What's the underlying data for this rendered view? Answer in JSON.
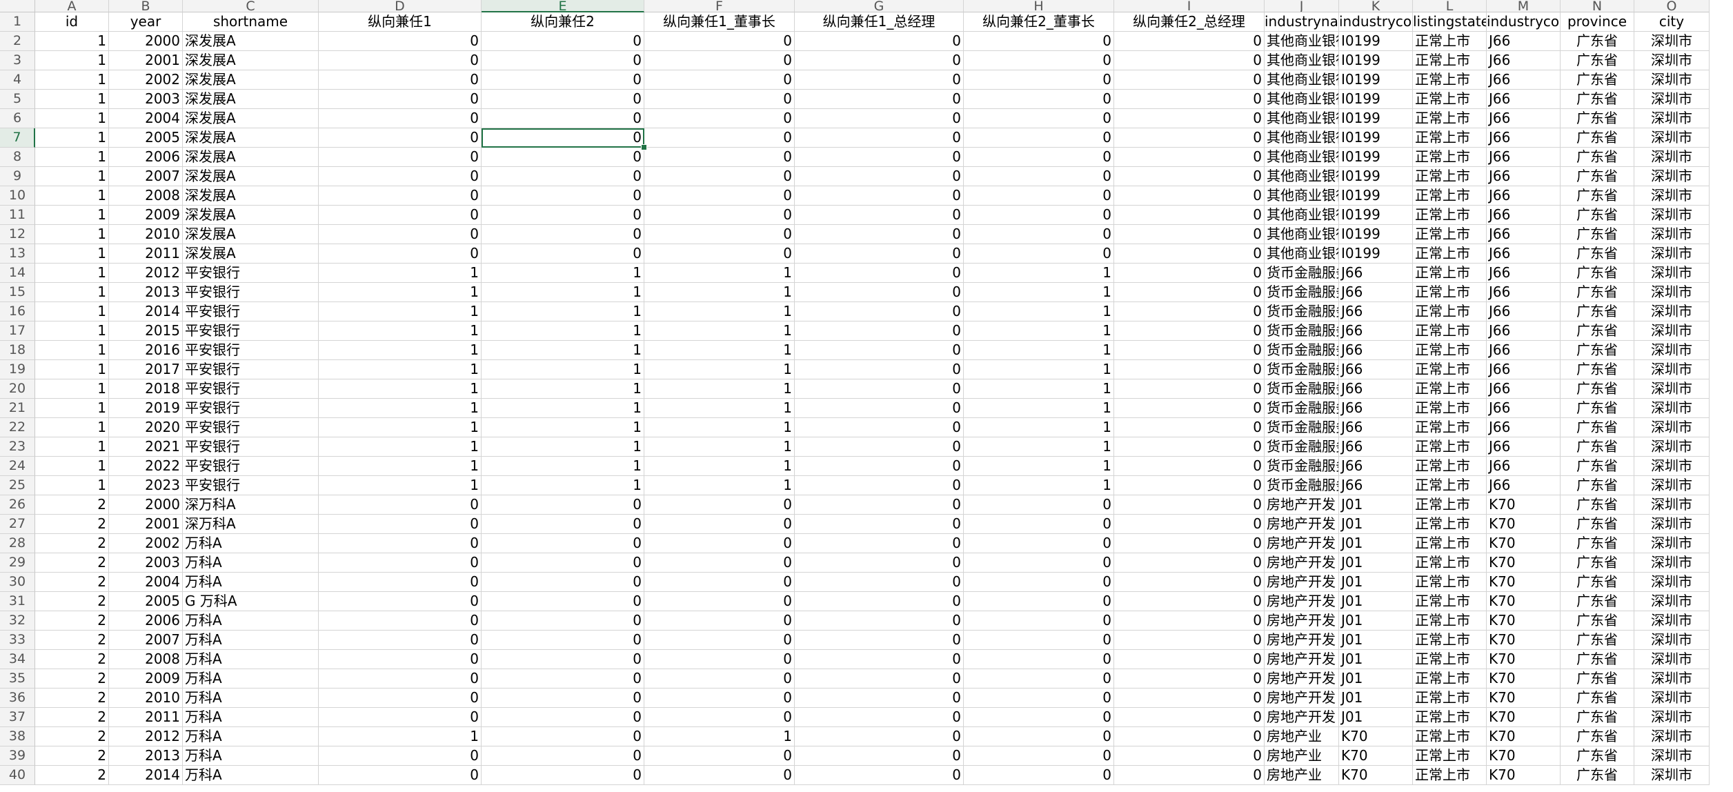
{
  "sheet": {
    "col_letters": [
      "A",
      "B",
      "C",
      "D",
      "E",
      "F",
      "G",
      "H",
      "I",
      "J",
      "K",
      "L",
      "M",
      "N",
      "O"
    ],
    "headers": [
      "id",
      "year",
      "shortname",
      "纵向兼任1",
      "纵向兼任2",
      "纵向兼任1_董事长",
      "纵向兼任1_总经理",
      "纵向兼任2_董事长",
      "纵向兼任2_总经理",
      "industryname",
      "industrycode",
      "listingstate",
      "industrycode",
      "province",
      "city"
    ],
    "active_cell": "E7",
    "rows": [
      [
        "1",
        "2000",
        "深发展A",
        "0",
        "0",
        "0",
        "0",
        "0",
        "0",
        "其他商业银行",
        "I0199",
        "正常上市",
        "J66",
        "广东省",
        "深圳市"
      ],
      [
        "1",
        "2001",
        "深发展A",
        "0",
        "0",
        "0",
        "0",
        "0",
        "0",
        "其他商业银行",
        "I0199",
        "正常上市",
        "J66",
        "广东省",
        "深圳市"
      ],
      [
        "1",
        "2002",
        "深发展A",
        "0",
        "0",
        "0",
        "0",
        "0",
        "0",
        "其他商业银行",
        "I0199",
        "正常上市",
        "J66",
        "广东省",
        "深圳市"
      ],
      [
        "1",
        "2003",
        "深发展A",
        "0",
        "0",
        "0",
        "0",
        "0",
        "0",
        "其他商业银行",
        "I0199",
        "正常上市",
        "J66",
        "广东省",
        "深圳市"
      ],
      [
        "1",
        "2004",
        "深发展A",
        "0",
        "0",
        "0",
        "0",
        "0",
        "0",
        "其他商业银行",
        "I0199",
        "正常上市",
        "J66",
        "广东省",
        "深圳市"
      ],
      [
        "1",
        "2005",
        "深发展A",
        "0",
        "0",
        "0",
        "0",
        "0",
        "0",
        "其他商业银行",
        "I0199",
        "正常上市",
        "J66",
        "广东省",
        "深圳市"
      ],
      [
        "1",
        "2006",
        "深发展A",
        "0",
        "0",
        "0",
        "0",
        "0",
        "0",
        "其他商业银行",
        "I0199",
        "正常上市",
        "J66",
        "广东省",
        "深圳市"
      ],
      [
        "1",
        "2007",
        "深发展A",
        "0",
        "0",
        "0",
        "0",
        "0",
        "0",
        "其他商业银行",
        "I0199",
        "正常上市",
        "J66",
        "广东省",
        "深圳市"
      ],
      [
        "1",
        "2008",
        "深发展A",
        "0",
        "0",
        "0",
        "0",
        "0",
        "0",
        "其他商业银行",
        "I0199",
        "正常上市",
        "J66",
        "广东省",
        "深圳市"
      ],
      [
        "1",
        "2009",
        "深发展A",
        "0",
        "0",
        "0",
        "0",
        "0",
        "0",
        "其他商业银行",
        "I0199",
        "正常上市",
        "J66",
        "广东省",
        "深圳市"
      ],
      [
        "1",
        "2010",
        "深发展A",
        "0",
        "0",
        "0",
        "0",
        "0",
        "0",
        "其他商业银行",
        "I0199",
        "正常上市",
        "J66",
        "广东省",
        "深圳市"
      ],
      [
        "1",
        "2011",
        "深发展A",
        "0",
        "0",
        "0",
        "0",
        "0",
        "0",
        "其他商业银行",
        "I0199",
        "正常上市",
        "J66",
        "广东省",
        "深圳市"
      ],
      [
        "1",
        "2012",
        "平安银行",
        "1",
        "1",
        "1",
        "0",
        "1",
        "0",
        "货币金融服务",
        "J66",
        "正常上市",
        "J66",
        "广东省",
        "深圳市"
      ],
      [
        "1",
        "2013",
        "平安银行",
        "1",
        "1",
        "1",
        "0",
        "1",
        "0",
        "货币金融服务",
        "J66",
        "正常上市",
        "J66",
        "广东省",
        "深圳市"
      ],
      [
        "1",
        "2014",
        "平安银行",
        "1",
        "1",
        "1",
        "0",
        "1",
        "0",
        "货币金融服务",
        "J66",
        "正常上市",
        "J66",
        "广东省",
        "深圳市"
      ],
      [
        "1",
        "2015",
        "平安银行",
        "1",
        "1",
        "1",
        "0",
        "1",
        "0",
        "货币金融服务",
        "J66",
        "正常上市",
        "J66",
        "广东省",
        "深圳市"
      ],
      [
        "1",
        "2016",
        "平安银行",
        "1",
        "1",
        "1",
        "0",
        "1",
        "0",
        "货币金融服务",
        "J66",
        "正常上市",
        "J66",
        "广东省",
        "深圳市"
      ],
      [
        "1",
        "2017",
        "平安银行",
        "1",
        "1",
        "1",
        "0",
        "1",
        "0",
        "货币金融服务",
        "J66",
        "正常上市",
        "J66",
        "广东省",
        "深圳市"
      ],
      [
        "1",
        "2018",
        "平安银行",
        "1",
        "1",
        "1",
        "0",
        "1",
        "0",
        "货币金融服务",
        "J66",
        "正常上市",
        "J66",
        "广东省",
        "深圳市"
      ],
      [
        "1",
        "2019",
        "平安银行",
        "1",
        "1",
        "1",
        "0",
        "1",
        "0",
        "货币金融服务",
        "J66",
        "正常上市",
        "J66",
        "广东省",
        "深圳市"
      ],
      [
        "1",
        "2020",
        "平安银行",
        "1",
        "1",
        "1",
        "0",
        "1",
        "0",
        "货币金融服务",
        "J66",
        "正常上市",
        "J66",
        "广东省",
        "深圳市"
      ],
      [
        "1",
        "2021",
        "平安银行",
        "1",
        "1",
        "1",
        "0",
        "1",
        "0",
        "货币金融服务",
        "J66",
        "正常上市",
        "J66",
        "广东省",
        "深圳市"
      ],
      [
        "1",
        "2022",
        "平安银行",
        "1",
        "1",
        "1",
        "0",
        "1",
        "0",
        "货币金融服务",
        "J66",
        "正常上市",
        "J66",
        "广东省",
        "深圳市"
      ],
      [
        "1",
        "2023",
        "平安银行",
        "1",
        "1",
        "1",
        "0",
        "1",
        "0",
        "货币金融服务",
        "J66",
        "正常上市",
        "J66",
        "广东省",
        "深圳市"
      ],
      [
        "2",
        "2000",
        "深万科A",
        "0",
        "0",
        "0",
        "0",
        "0",
        "0",
        "房地产开发",
        "J01",
        "正常上市",
        "K70",
        "广东省",
        "深圳市"
      ],
      [
        "2",
        "2001",
        "深万科A",
        "0",
        "0",
        "0",
        "0",
        "0",
        "0",
        "房地产开发",
        "J01",
        "正常上市",
        "K70",
        "广东省",
        "深圳市"
      ],
      [
        "2",
        "2002",
        "万科A",
        "0",
        "0",
        "0",
        "0",
        "0",
        "0",
        "房地产开发",
        "J01",
        "正常上市",
        "K70",
        "广东省",
        "深圳市"
      ],
      [
        "2",
        "2003",
        "万科A",
        "0",
        "0",
        "0",
        "0",
        "0",
        "0",
        "房地产开发",
        "J01",
        "正常上市",
        "K70",
        "广东省",
        "深圳市"
      ],
      [
        "2",
        "2004",
        "万科A",
        "0",
        "0",
        "0",
        "0",
        "0",
        "0",
        "房地产开发",
        "J01",
        "正常上市",
        "K70",
        "广东省",
        "深圳市"
      ],
      [
        "2",
        "2005",
        "G 万科A",
        "0",
        "0",
        "0",
        "0",
        "0",
        "0",
        "房地产开发",
        "J01",
        "正常上市",
        "K70",
        "广东省",
        "深圳市"
      ],
      [
        "2",
        "2006",
        "万科A",
        "0",
        "0",
        "0",
        "0",
        "0",
        "0",
        "房地产开发",
        "J01",
        "正常上市",
        "K70",
        "广东省",
        "深圳市"
      ],
      [
        "2",
        "2007",
        "万科A",
        "0",
        "0",
        "0",
        "0",
        "0",
        "0",
        "房地产开发",
        "J01",
        "正常上市",
        "K70",
        "广东省",
        "深圳市"
      ],
      [
        "2",
        "2008",
        "万科A",
        "0",
        "0",
        "0",
        "0",
        "0",
        "0",
        "房地产开发",
        "J01",
        "正常上市",
        "K70",
        "广东省",
        "深圳市"
      ],
      [
        "2",
        "2009",
        "万科A",
        "0",
        "0",
        "0",
        "0",
        "0",
        "0",
        "房地产开发",
        "J01",
        "正常上市",
        "K70",
        "广东省",
        "深圳市"
      ],
      [
        "2",
        "2010",
        "万科A",
        "0",
        "0",
        "0",
        "0",
        "0",
        "0",
        "房地产开发",
        "J01",
        "正常上市",
        "K70",
        "广东省",
        "深圳市"
      ],
      [
        "2",
        "2011",
        "万科A",
        "0",
        "0",
        "0",
        "0",
        "0",
        "0",
        "房地产开发",
        "J01",
        "正常上市",
        "K70",
        "广东省",
        "深圳市"
      ],
      [
        "2",
        "2012",
        "万科A",
        "1",
        "0",
        "1",
        "0",
        "0",
        "0",
        "房地产业",
        "K70",
        "正常上市",
        "K70",
        "广东省",
        "深圳市"
      ],
      [
        "2",
        "2013",
        "万科A",
        "0",
        "0",
        "0",
        "0",
        "0",
        "0",
        "房地产业",
        "K70",
        "正常上市",
        "K70",
        "广东省",
        "深圳市"
      ],
      [
        "2",
        "2014",
        "万科A",
        "0",
        "0",
        "0",
        "0",
        "0",
        "0",
        "房地产业",
        "K70",
        "正常上市",
        "K70",
        "广东省",
        "深圳市"
      ]
    ]
  }
}
